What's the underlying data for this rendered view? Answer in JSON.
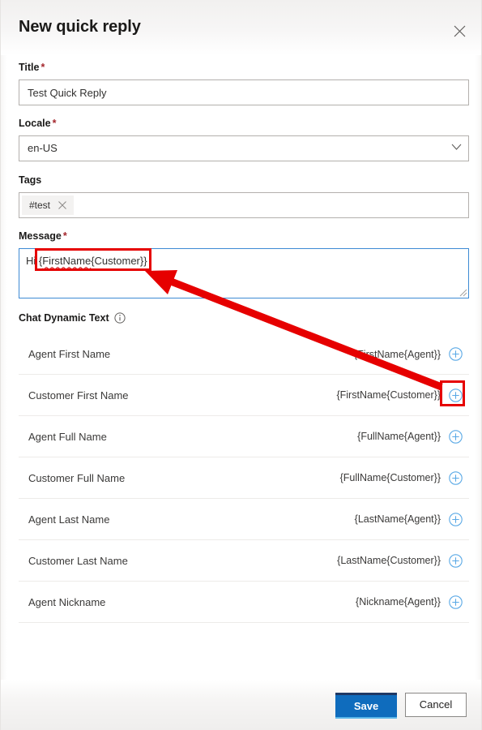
{
  "dialog": {
    "title": "New quick reply",
    "close_icon": "close-icon"
  },
  "form": {
    "title_field": {
      "label": "Title",
      "required_marker": "*",
      "value": "Test Quick Reply"
    },
    "locale_field": {
      "label": "Locale",
      "required_marker": "*",
      "value": "en-US",
      "chevron_icon": "chevron-down-icon"
    },
    "tags_field": {
      "label": "Tags",
      "chips": [
        {
          "label": "#test",
          "remove_icon": "close-icon"
        }
      ]
    },
    "message_field": {
      "label": "Message",
      "required_marker": "*",
      "value_prefix": "Hi ",
      "value_token_start": "{",
      "value_misspelled": "FirstName",
      "value_token_end": "{Customer}}",
      "full_value": "Hi {FirstName{Customer}}",
      "resize_handle_icon": "resize-grip-icon"
    }
  },
  "dynamic_text": {
    "heading": "Chat Dynamic Text",
    "info_icon": "info-icon",
    "add_icon": "circle-plus-icon",
    "rows": [
      {
        "label": "Agent First Name",
        "token": "{FirstName{Agent}}"
      },
      {
        "label": "Customer First Name",
        "token": "{FirstName{Customer}}"
      },
      {
        "label": "Agent Full Name",
        "token": "{FullName{Agent}}"
      },
      {
        "label": "Customer Full Name",
        "token": "{FullName{Customer}}"
      },
      {
        "label": "Agent Last Name",
        "token": "{LastName{Agent}}"
      },
      {
        "label": "Customer Last Name",
        "token": "{LastName{Customer}}"
      },
      {
        "label": "Agent Nickname",
        "token": "{Nickname{Agent}}"
      }
    ]
  },
  "footer": {
    "save_label": "Save",
    "cancel_label": "Cancel"
  },
  "colors": {
    "primary_button": "#0f6cbd",
    "focus_border": "#3d8ad4",
    "required_asterisk": "#a4262c",
    "annotation": "#e60000",
    "add_icon": "#5aa9e6"
  }
}
